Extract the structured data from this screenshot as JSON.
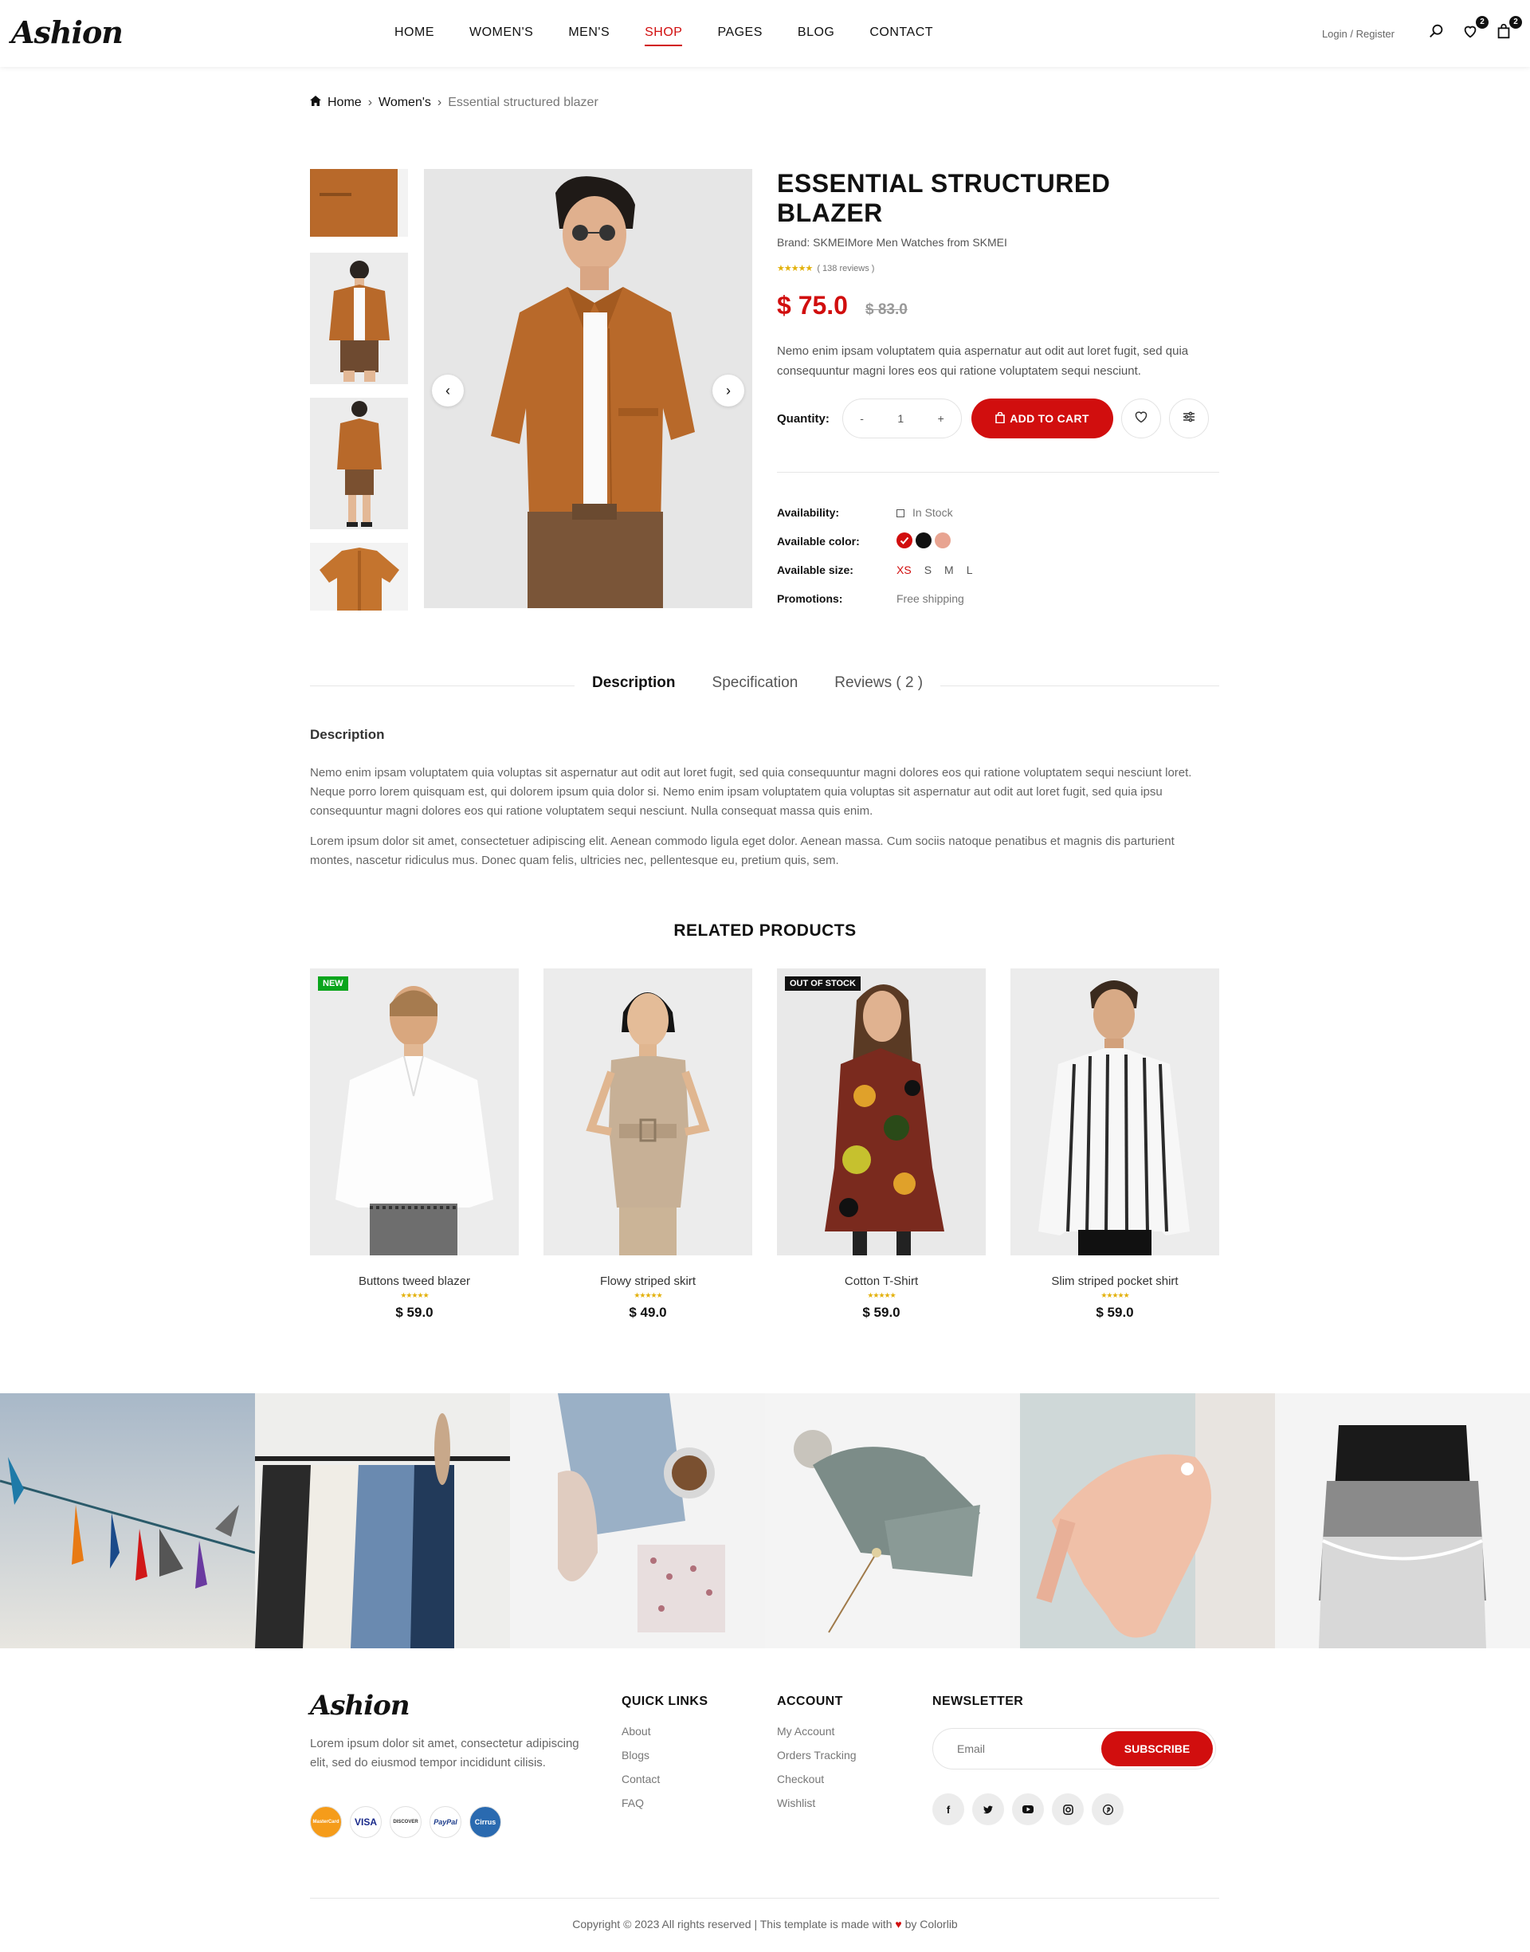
{
  "header": {
    "logo": "Ashion",
    "nav": [
      {
        "label": "HOME"
      },
      {
        "label": "WOMEN'S"
      },
      {
        "label": "MEN'S"
      },
      {
        "label": "SHOP",
        "active": true
      },
      {
        "label": "PAGES"
      },
      {
        "label": "BLOG"
      },
      {
        "label": "CONTACT"
      }
    ],
    "login": "Login / Register",
    "wishlist_count": "2",
    "cart_count": "2"
  },
  "breadcrumb": {
    "home": "Home",
    "category": "Women's",
    "current": "Essential structured blazer"
  },
  "product": {
    "title": "ESSENTIAL STRUCTURED BLAZER",
    "brand": "Brand: SKMEIMore Men Watches from SKMEI",
    "stars": "★★★★★",
    "reviews": "( 138 reviews )",
    "price": "$ 75.0",
    "old_price": "$ 83.0",
    "description": "Nemo enim ipsam voluptatem quia aspernatur aut odit aut loret fugit, sed quia consequuntur magni lores eos qui ratione voluptatem sequi nesciunt.",
    "quantity_label": "Quantity:",
    "quantity_minus": "-",
    "quantity_value": "1",
    "quantity_plus": "+",
    "add_to_cart": "ADD TO CART",
    "availability_label": "Availability:",
    "availability_value": "In Stock",
    "color_label": "Available color:",
    "colors": [
      "#d10e0e",
      "#111111",
      "#e8a491"
    ],
    "size_label": "Available size:",
    "sizes": [
      "XS",
      "S",
      "M",
      "L"
    ],
    "selected_size": "XS",
    "promotions_label": "Promotions:",
    "promotions_value": "Free shipping"
  },
  "tabs": {
    "items": [
      "Description",
      "Specification",
      "Reviews ( 2 )"
    ],
    "active": "Description",
    "heading": "Description",
    "paragraphs": [
      "Nemo enim ipsam voluptatem quia voluptas sit aspernatur aut odit aut loret fugit, sed quia consequuntur magni dolores eos qui ratione voluptatem sequi nesciunt loret. Neque porro lorem quisquam est, qui dolorem ipsum quia dolor si. Nemo enim ipsam voluptatem quia voluptas sit aspernatur aut odit aut loret fugit, sed quia ipsu consequuntur magni dolores eos qui ratione voluptatem sequi nesciunt. Nulla consequat massa quis enim.",
      "Lorem ipsum dolor sit amet, consectetuer adipiscing elit. Aenean commodo ligula eget dolor. Aenean massa. Cum sociis natoque penatibus et magnis dis parturient montes, nascetur ridiculus mus. Donec quam felis, ultricies nec, pellentesque eu, pretium quis, sem."
    ]
  },
  "related": {
    "title": "RELATED PRODUCTS",
    "products": [
      {
        "name": "Buttons tweed blazer",
        "price": "$ 59.0",
        "stars": "★★★★★",
        "badge": "NEW",
        "badge_color": "#0aa51c"
      },
      {
        "name": "Flowy striped skirt",
        "price": "$ 49.0",
        "stars": "★★★★★",
        "badge": "",
        "badge_color": ""
      },
      {
        "name": "Cotton T-Shirt",
        "price": "$ 59.0",
        "stars": "★★★★★",
        "badge": "OUT OF STOCK",
        "badge_color": "#111111"
      },
      {
        "name": "Slim striped pocket shirt",
        "price": "$ 59.0",
        "stars": "★★★★★",
        "badge": "",
        "badge_color": ""
      }
    ]
  },
  "footer": {
    "logo": "Ashion",
    "about": "Lorem ipsum dolor sit amet, consectetur adipiscing elit, sed do eiusmod tempor incididunt cilisis.",
    "payments": [
      "MasterCard",
      "VISA",
      "DISCOVER",
      "PayPal",
      "Cirrus"
    ],
    "quick_links": {
      "title": "QUICK LINKS",
      "items": [
        "About",
        "Blogs",
        "Contact",
        "FAQ"
      ]
    },
    "account": {
      "title": "ACCOUNT",
      "items": [
        "My Account",
        "Orders Tracking",
        "Checkout",
        "Wishlist"
      ]
    },
    "newsletter": {
      "title": "NEWSLETTER",
      "placeholder": "Email",
      "button": "SUBSCRIBE"
    },
    "socials": [
      "facebook-icon",
      "twitter-icon",
      "youtube-icon",
      "instagram-icon",
      "pinterest-icon"
    ],
    "copyright_pre": "Copyright © 2023 All rights reserved | This template is made with",
    "copyright_post": "by Colorlib"
  }
}
